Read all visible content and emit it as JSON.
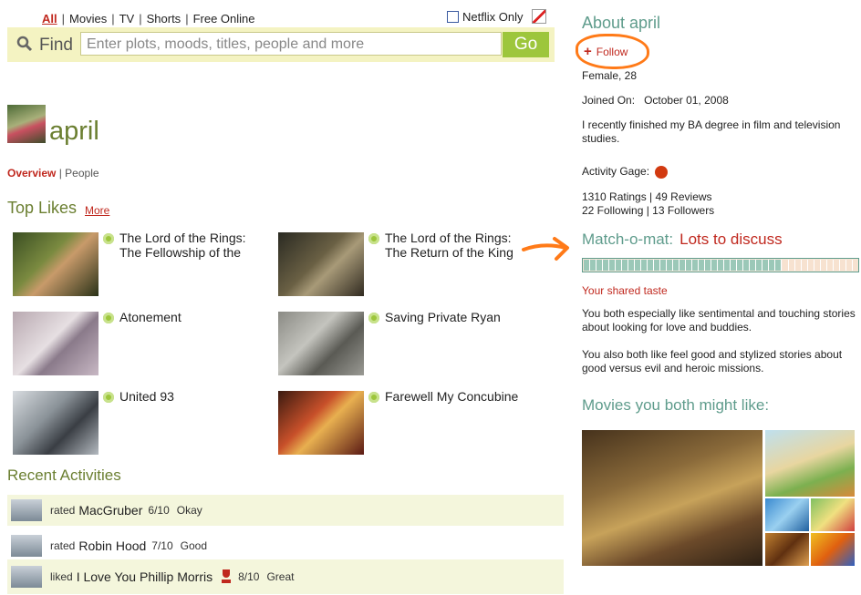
{
  "nav": {
    "items": [
      "All",
      "Movies",
      "TV",
      "Shorts",
      "Free Online"
    ],
    "netflix_only": "Netflix Only"
  },
  "search": {
    "label": "Find",
    "placeholder": "Enter plots, moods, titles, people and more",
    "button": "Go"
  },
  "profile": {
    "name": "april",
    "tabs": [
      "Overview",
      "People"
    ]
  },
  "top_likes": {
    "heading": "Top Likes",
    "more": "More",
    "items": [
      {
        "title": "The Lord of the Rings: The Fellowship of the"
      },
      {
        "title": "The Lord of the Rings: The Return of the King"
      },
      {
        "title": "Atonement"
      },
      {
        "title": "Saving Private Ryan"
      },
      {
        "title": "United 93"
      },
      {
        "title": "Farewell My Concubine"
      }
    ]
  },
  "recent": {
    "heading": "Recent Activities",
    "items": [
      {
        "verb": "rated",
        "title": "MacGruber",
        "score": "6/10",
        "word": "Okay"
      },
      {
        "verb": "rated",
        "title": "Robin Hood",
        "score": "7/10",
        "word": "Good"
      },
      {
        "verb": "liked",
        "title": "I Love You Phillip Morris",
        "score": "8/10",
        "word": "Great"
      }
    ]
  },
  "about": {
    "heading": "About april",
    "follow": "Follow",
    "gender_age": "Female, 28",
    "joined_label": "Joined On:",
    "joined_date": "October 01, 2008",
    "bio": "I recently finished my BA degree in film and television studies.",
    "activity_label": "Activity Gage:",
    "ratings_line": "1310 Ratings | 49 Reviews",
    "following_line": "22 Following | 13 Followers"
  },
  "match": {
    "label": "Match-o-mat:",
    "verdict": "Lots to discuss",
    "level_pct": 72,
    "shared_heading": "Your shared taste",
    "para1": "You both especially like sentimental and touching stories about looking for love and buddies.",
    "para2": "You also both like feel good and stylized stories about good versus evil and heroic missions."
  },
  "recommend": {
    "heading": "Movies you both might like:"
  },
  "colors": {
    "accent_red": "#c0281e",
    "olive": "#6b7f31",
    "teal": "#5f9c8c",
    "go_green": "#9dc63c",
    "annotation_orange": "#ff7a18"
  }
}
